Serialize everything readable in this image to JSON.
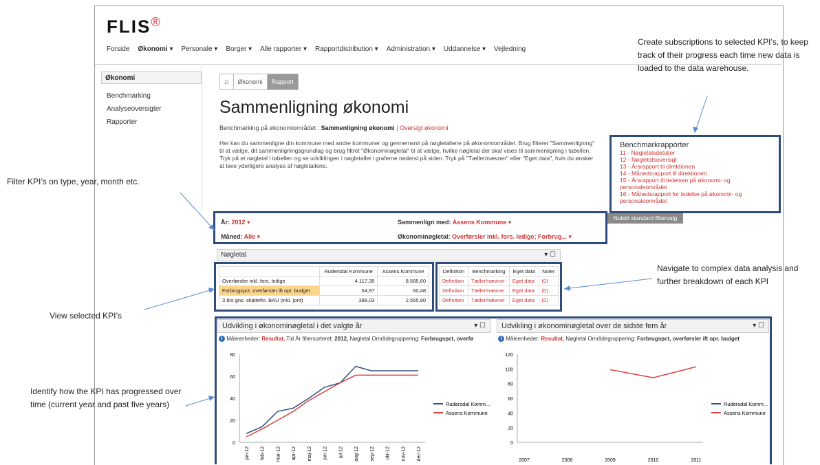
{
  "app": {
    "logo": "FLIS",
    "logo_mark": "®"
  },
  "nav": [
    "Forside",
    "Økonomi ▾",
    "Personale ▾",
    "Borger ▾",
    "Alle rapporter ▾",
    "Rapportdistribution ▾",
    "Administration ▾",
    "Uddannelse ▾",
    "Vejledning"
  ],
  "sidebar": {
    "title": "Økonomi",
    "items": [
      "Benchmarking",
      "Analyseoversigter",
      "Rapporter"
    ]
  },
  "breadcrumb": {
    "home_icon": "home-icon",
    "items": [
      "Økonomi",
      "Rapport"
    ]
  },
  "page": {
    "title": "Sammenligning økonomi",
    "sub_prefix": "Benchmarking på økonomiområdet :",
    "sub_current": "Sammenligning økonomi",
    "sub_sep": "|",
    "sub_link": "Oversigt økonomi",
    "description": "Her kan du sammenligne din kommune med andre kommuner og gennemsnit på nøgletallene på økonomiområdet. Brug filteret \"Sammenligning\" til at vælge, dit sammenligningsgrundlag og brug filtret \"Økonominøgletal\" til at vælge, hvilke nøgletal der skal vises til sammenligning i tabellen. Tryk på et nøgletal i tabellen og se udviklingen i nøgletallet i graferne nederst på siden. Tryk på \"Tæller/nævner\" eller \"Eget data\", hvis du ønsker at lave yderligere analyse af nøgletallene."
  },
  "benchmark": {
    "title": "Benchmarkrapporter",
    "items": [
      "11 - Nøgletalsdetaljer",
      "12 - Nøgletalsoversigt",
      "13 - Årsrapport til direktionen",
      "14 - Månedsrapport til direktionen",
      "15 - Årsrapport til ledelsen på økonomi- og",
      "personaleområdet",
      "16 - Månedsrapport for ledelse på økonomi- og",
      "personaleområdet"
    ]
  },
  "reset_button": "Nulstil standard filtervalg",
  "filters": {
    "year_label": "År:",
    "year_value": "2012 ▾",
    "month_label": "Måned:",
    "month_value": "Alle ▾",
    "compare_label": "Sammenlign med:",
    "compare_value": "Assens Kommune ▾",
    "kpi_label": "Økonominøgletal:",
    "kpi_value": "Overførsler inkl. fors. ledige; Forbrug... ▾"
  },
  "kpi_panel": {
    "title": "Nøgletal",
    "controls": "▾ ☐"
  },
  "kpi_table": {
    "headers": [
      "",
      "Rudersdal Kommune",
      "Assens Kommune"
    ],
    "rows": [
      [
        "Overførsler inkl. fors. ledige",
        "4.117,35",
        "8.585,60"
      ],
      [
        "Forbrugspct, overførsler ift opr. budget",
        "64,97",
        "60,48"
      ],
      [
        "3 års gns. skattefin. BAU (inkl. jord)",
        "388,03",
        "2.555,90"
      ]
    ]
  },
  "link_table": {
    "headers": [
      "Definition",
      "Benchmarking",
      "Eget data",
      "Noter"
    ],
    "rows": [
      [
        "Definition",
        "Tæller/nævner",
        "Eget data",
        "(0)"
      ],
      [
        "Definition",
        "Tæller/nævner",
        "Eget data",
        "(0)"
      ],
      [
        "Definition",
        "Tæller/nævner",
        "Eget data",
        "(0)"
      ]
    ]
  },
  "annotations": {
    "subscriptions": "Create subscriptions to selected KPI’s, to keep track of their progress each time new data is loaded to the data warehouse.",
    "filter": "Filter KPI’s on type, year, month etc.",
    "navigate": "Navigate to complex data analysis and further breakdown of each KPI",
    "view": "View selected KPI’s",
    "identify": "Identify how the KPI has progressed over time (current year and past five years)"
  },
  "charts": {
    "left_title": "Udvikling i økonominøgletal i det valgte år",
    "left_meta_prefix": "Måleenheder:",
    "left_meta_bold": "Resultat,",
    "left_meta_rest": "Tid År filtersorteret:",
    "left_meta_year": "2012,",
    "left_meta_rest2": "Nøgletal Områdegruppering:",
    "left_meta_kpi": "Forbrugspct, overfø",
    "right_title": "Udvikling i økonominøgletal over de sidste fem år",
    "right_meta_prefix": "Måleenheder:",
    "right_meta_bold": "Resultat,",
    "right_meta_rest": "Nøgletal Områdegruppering:",
    "right_meta_kpi": "Forbrugspct, overførsler ift opr. budget",
    "controls": "▾ ☐"
  },
  "chart_data": [
    {
      "type": "line",
      "categories": [
        "jan-12",
        "feb-12",
        "mar-12",
        "apr-12",
        "maj-12",
        "jun-12",
        "jul-12",
        "aug-12",
        "sep-12",
        "okt-12",
        "nov-12",
        "dec-12"
      ],
      "series": [
        {
          "name": "Rudersdal Komm...",
          "values": [
            8,
            14,
            28,
            31,
            40,
            50,
            54,
            69,
            65,
            65,
            65,
            65
          ],
          "color": "#2f4f7f"
        },
        {
          "name": "Assens Kommune",
          "values": [
            5,
            12,
            20,
            28,
            38,
            46,
            54,
            61,
            61,
            61,
            61,
            61
          ],
          "color": "#d9413d"
        }
      ],
      "ylim": [
        0,
        80
      ],
      "yticks": [
        0,
        20,
        40,
        60,
        80
      ],
      "legend": "right"
    },
    {
      "type": "line",
      "categories": [
        "2007",
        "2008",
        "2009",
        "2010",
        "2011"
      ],
      "series": [
        {
          "name": "Rudersdal Komm...",
          "values": [
            null,
            null,
            null,
            null,
            null
          ],
          "color": "#2f4f7f"
        },
        {
          "name": "Assens Kommune",
          "values": [
            null,
            null,
            99,
            88,
            103
          ],
          "color": "#d9413d"
        }
      ],
      "ylim": [
        0,
        120
      ],
      "yticks": [
        0,
        20,
        40,
        60,
        80,
        100,
        120
      ],
      "legend": "right"
    }
  ]
}
